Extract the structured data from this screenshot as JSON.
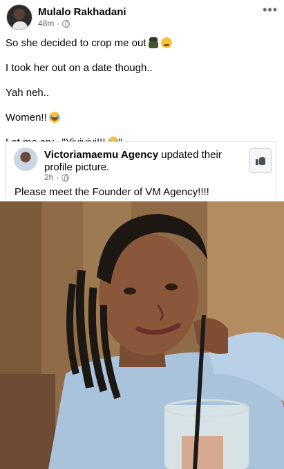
{
  "post": {
    "author": "Mulalo Rakhadani",
    "time": "48m",
    "separator": "·",
    "privacy_icon": "globe-icon",
    "more_icon": "more-horizontal-icon",
    "more_label": "•••",
    "lines": [
      "So she decided to crop me out",
      "I took her out on a date though..",
      "Yah neh..",
      "Women!!",
      "Let me cry.. \"Yiyiyiyi!!!"
    ],
    "closing_quote": "\""
  },
  "shared": {
    "name": "Victoriamaemu Agency",
    "action": " updated their profile picture.",
    "time": "2h",
    "separator": "·",
    "caption": "Please meet the Founder of VM Agency!!!!",
    "like_icon": "thumbs-up-icon"
  },
  "photo": {
    "description_icon": "profile-photo"
  }
}
